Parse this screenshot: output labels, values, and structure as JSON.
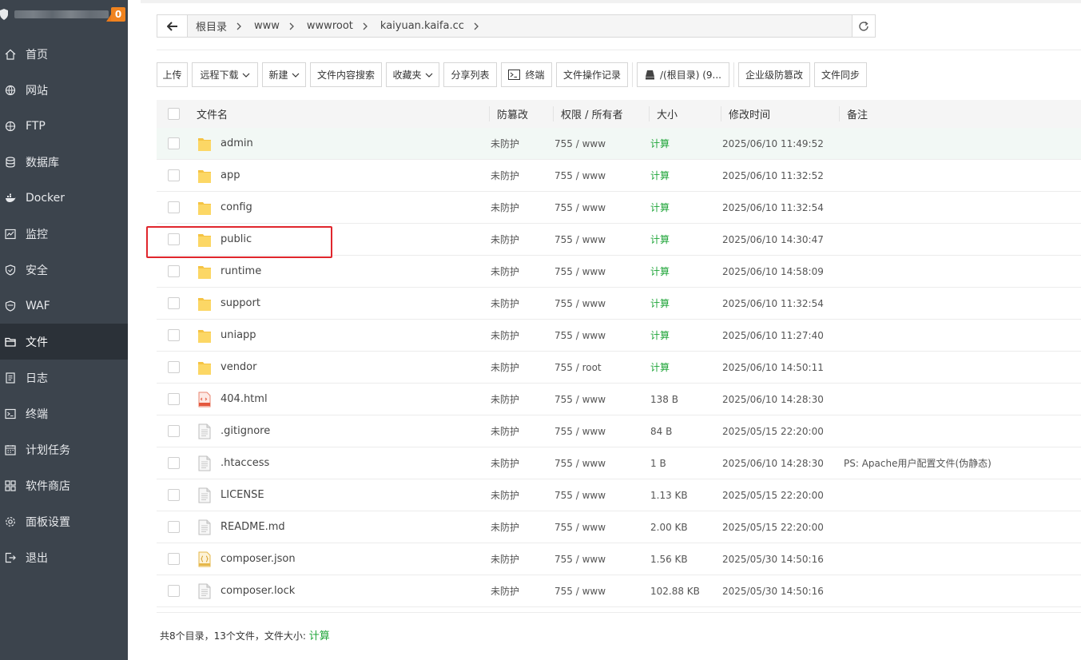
{
  "sidebar": {
    "notice_count": "0",
    "items": [
      {
        "label": "首页",
        "icon": "home-icon"
      },
      {
        "label": "网站",
        "icon": "globe-icon"
      },
      {
        "label": "FTP",
        "icon": "ftp-globe-icon"
      },
      {
        "label": "数据库",
        "icon": "database-icon"
      },
      {
        "label": "Docker",
        "icon": "docker-icon"
      },
      {
        "label": "监控",
        "icon": "monitor-icon"
      },
      {
        "label": "安全",
        "icon": "shield-icon"
      },
      {
        "label": "WAF",
        "icon": "waf-shield-icon"
      },
      {
        "label": "文件",
        "icon": "folder-icon"
      },
      {
        "label": "日志",
        "icon": "log-icon"
      },
      {
        "label": "终端",
        "icon": "terminal-icon"
      },
      {
        "label": "计划任务",
        "icon": "schedule-icon"
      },
      {
        "label": "软件商店",
        "icon": "store-icon"
      },
      {
        "label": "面板设置",
        "icon": "settings-icon"
      },
      {
        "label": "退出",
        "icon": "logout-icon"
      }
    ],
    "active": "文件"
  },
  "breadcrumb": [
    "根目录",
    "www",
    "wwwroot",
    "kaiyuan.kaifa.cc"
  ],
  "toolbar": {
    "upload": "上传",
    "remote_download": "远程下载",
    "new": "新建",
    "content_search": "文件内容搜索",
    "favorites": "收藏夹",
    "share_list": "分享列表",
    "terminal": "终端",
    "op_log": "文件操作记录",
    "disk": "/(根目录) (9...",
    "tamper": "企业级防篡改",
    "sync": "文件同步"
  },
  "table": {
    "headers": {
      "name": "文件名",
      "protect": "防篡改",
      "perm": "权限 / 所有者",
      "size": "大小",
      "mtime": "修改时间",
      "note": "备注"
    },
    "rows": [
      {
        "name": "admin",
        "type": "folder",
        "protect": "未防护",
        "perm": "755 / www",
        "size": "计算",
        "mtime": "2025/06/10 11:49:52",
        "note": ""
      },
      {
        "name": "app",
        "type": "folder",
        "protect": "未防护",
        "perm": "755 / www",
        "size": "计算",
        "mtime": "2025/06/10 11:32:52",
        "note": ""
      },
      {
        "name": "config",
        "type": "folder",
        "protect": "未防护",
        "perm": "755 / www",
        "size": "计算",
        "mtime": "2025/06/10 11:32:54",
        "note": ""
      },
      {
        "name": "public",
        "type": "folder",
        "protect": "未防护",
        "perm": "755 / www",
        "size": "计算",
        "mtime": "2025/06/10 14:30:47",
        "note": ""
      },
      {
        "name": "runtime",
        "type": "folder",
        "protect": "未防护",
        "perm": "755 / www",
        "size": "计算",
        "mtime": "2025/06/10 14:58:09",
        "note": ""
      },
      {
        "name": "support",
        "type": "folder",
        "protect": "未防护",
        "perm": "755 / www",
        "size": "计算",
        "mtime": "2025/06/10 11:32:54",
        "note": ""
      },
      {
        "name": "uniapp",
        "type": "folder",
        "protect": "未防护",
        "perm": "755 / www",
        "size": "计算",
        "mtime": "2025/06/10 11:27:40",
        "note": ""
      },
      {
        "name": "vendor",
        "type": "folder",
        "protect": "未防护",
        "perm": "755 / root",
        "size": "计算",
        "mtime": "2025/06/10 14:50:11",
        "note": ""
      },
      {
        "name": "404.html",
        "type": "html",
        "protect": "未防护",
        "perm": "755 / www",
        "size": "138 B",
        "mtime": "2025/06/10 14:28:30",
        "note": ""
      },
      {
        "name": ".gitignore",
        "type": "file",
        "protect": "未防护",
        "perm": "755 / www",
        "size": "84 B",
        "mtime": "2025/05/15 22:20:00",
        "note": ""
      },
      {
        "name": ".htaccess",
        "type": "file",
        "protect": "未防护",
        "perm": "755 / www",
        "size": "1 B",
        "mtime": "2025/06/10 14:28:30",
        "note": "PS: Apache用户配置文件(伪静态)"
      },
      {
        "name": "LICENSE",
        "type": "file",
        "protect": "未防护",
        "perm": "755 / www",
        "size": "1.13 KB",
        "mtime": "2025/05/15 22:20:00",
        "note": ""
      },
      {
        "name": "README.md",
        "type": "file",
        "protect": "未防护",
        "perm": "755 / www",
        "size": "2.00 KB",
        "mtime": "2025/05/15 22:20:00",
        "note": ""
      },
      {
        "name": "composer.json",
        "type": "json",
        "protect": "未防护",
        "perm": "755 / www",
        "size": "1.56 KB",
        "mtime": "2025/05/30 14:50:16",
        "note": ""
      },
      {
        "name": "composer.lock",
        "type": "file",
        "protect": "未防护",
        "perm": "755 / www",
        "size": "102.88 KB",
        "mtime": "2025/05/30 14:50:16",
        "note": ""
      }
    ]
  },
  "summary": {
    "text": "共8个目录，13个文件，文件大小: ",
    "calc": "计算"
  },
  "colors": {
    "sidebar_bg": "#3c444d",
    "sidebar_active": "#2b3138",
    "accent_green": "#20a53a",
    "badge_orange": "#f0831f",
    "highlight_red": "#e0262d"
  }
}
